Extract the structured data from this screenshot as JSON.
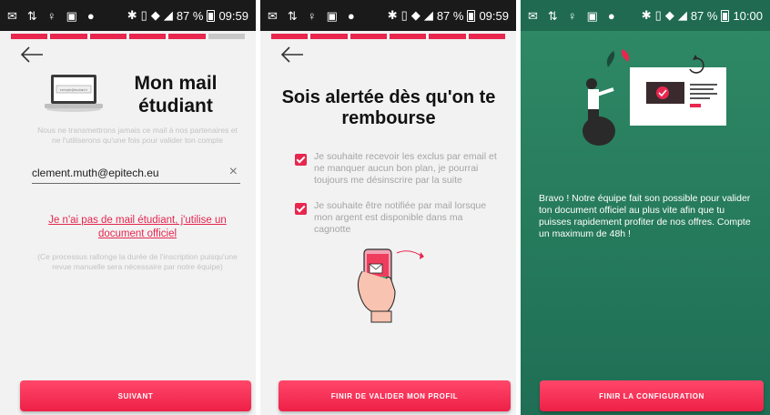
{
  "status_bar": {
    "battery": "87 %",
    "time_1": "09:59",
    "time_2": "09:59",
    "time_3": "10:00"
  },
  "progress": {
    "filled_segments_screen1": 5,
    "filled_segments_screen2": 6,
    "total_segments": 6
  },
  "screen1": {
    "title": "Mon mail étudiant",
    "laptop_text": "exemple@etudiant.fr",
    "hint": "Nous ne transmettrons jamais ce mail à nos partenaires et ne l'utiliserons qu'une fois pour valider ton compte",
    "email_value": "clement.muth@epitech.eu",
    "no_mail_link": "Je n'ai pas de mail étudiant, j'utilise un document officiel",
    "process_note": "(Ce processus rallonge la durée de l'inscription puisqu'une revue manuelle sera nécessaire par notre équipe)",
    "next_button": "SUIVANT"
  },
  "screen2": {
    "title": "Sois alertée dès qu'on te rembourse",
    "checkbox_1": "Je souhaite recevoir les exclus par email et ne manquer aucun bon plan, je pourrai toujours me désinscrire par la suite",
    "checkbox_2": "Je souhaite être notifiée par mail lorsque mon argent est disponible dans ma cagnotte",
    "finish_button": "FINIR DE VALIDER MON PROFIL"
  },
  "screen3": {
    "message": "Bravo ! Notre équipe fait son possible pour valider ton document officiel au plus vite afin que tu puisses rapidement profiter de nos offres. Compte un maximum de 48h !",
    "config_button": "FINIR LA CONFIGURATION"
  },
  "colors": {
    "accent": "#e8264e",
    "green": "#2a8261",
    "status_bar": "#1a1a1a"
  }
}
